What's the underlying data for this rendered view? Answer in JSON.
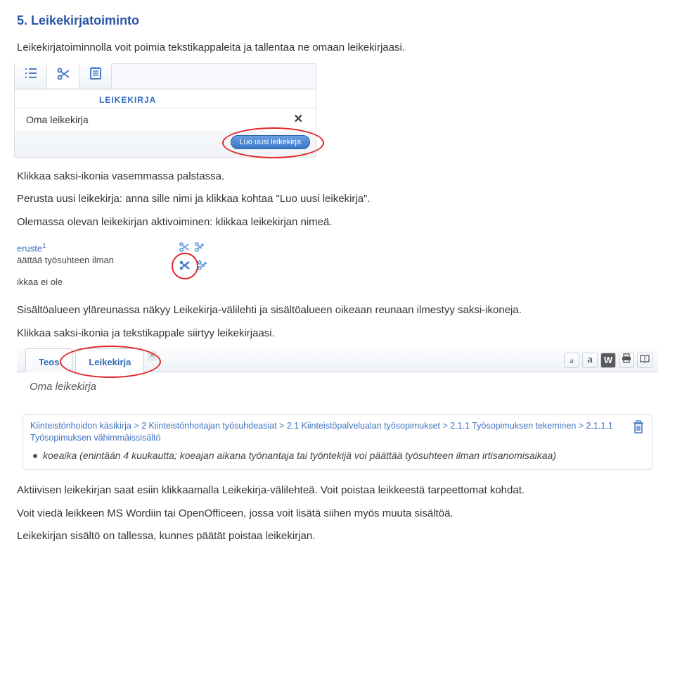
{
  "section": {
    "title": "5.  Leikekirjatoiminto",
    "intro": "Leikekirjatoiminnolla voit poimia tekstikappaleita ja tallentaa ne omaan leikekirjaasi.",
    "p2": "Klikkaa saksi-ikonia vasemmassa palstassa.",
    "p3": "Perusta uusi leikekirja: anna sille nimi ja klikkaa kohtaa \"Luo uusi leikekirja\".",
    "p4": "Olemassa olevan leikekirjan aktivoiminen: klikkaa leikekirjan nimeä.",
    "p5": "Sisältöalueen yläreunassa näkyy Leikekirja-välilehti ja sisältöalueen oikeaan reunaan ilmestyy saksi-ikoneja.",
    "p6": "Klikkaa saksi-ikonia ja tekstikappale siirtyy leikekirjaasi.",
    "p7": "Aktiivisen leikekirjan saat esiin klikkaamalla Leikekirja-välilehteä. Voit poistaa leikkeestä tarpeettomat kohdat.",
    "p8": "Voit viedä leikkeen MS Wordiin tai OpenOfficeen, jossa voit lisätä siihen myös muuta sisältöä.",
    "p9": "Leikekirjan sisältö on tallessa, kunnes päätät poistaa leikekirjan."
  },
  "fig1": {
    "heading": "LEIKEKIRJA",
    "input_value": "Oma leikekirja",
    "clear_glyph": "✕",
    "create_btn": "Luo uusi leikekirja"
  },
  "fig2": {
    "line1a": "eruste",
    "line1_sup": "1",
    "line2": "äättää työsuhteen ilman",
    "line3": "ikkaa ei ole"
  },
  "fig3": {
    "tab1": "Teos",
    "tab2": "Leikekirja",
    "close_glyph": "✕",
    "tool_a_small": "a",
    "tool_a_big": "a",
    "tool_w": "W",
    "subtitle": "Oma leikekirja",
    "breadcrumb": "Kiinteistönhoidon käsikirja > 2 Kiinteistönhoitajan työsuhdeasiat > 2.1 Kiinteistöpalvelualan työsopimukset > 2.1.1 Työsopimuksen tekeminen > 2.1.1.1 Työsopimuksen vähimmäissisältö",
    "bullet": "koeaika (enintään 4 kuukautta; koeajan aikana työnantaja tai työntekijä voi päättää työsuhteen ilman irtisanomisaikaa)"
  }
}
